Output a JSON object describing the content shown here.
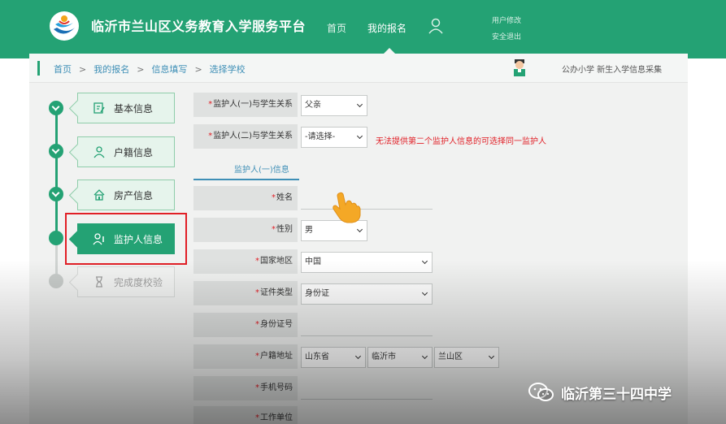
{
  "header": {
    "site_title": "临沂市兰山区义务教育入学服务平台",
    "nav_home": "首页",
    "nav_mine": "我的报名",
    "user_links": [
      "用户修改",
      "安全退出"
    ]
  },
  "breadcrumb": {
    "items": [
      "首页",
      "我的报名",
      "信息填写",
      "选择学校"
    ],
    "separator": ">"
  },
  "page_note": "公办小学 新生入学信息采集",
  "steps": [
    {
      "label": "基本信息",
      "icon": "form-edit-icon",
      "state": "done"
    },
    {
      "label": "户籍信息",
      "icon": "user-icon",
      "state": "done"
    },
    {
      "label": "房产信息",
      "icon": "house-icon",
      "state": "done"
    },
    {
      "label": "监护人信息",
      "icon": "guardian-icon",
      "state": "active"
    },
    {
      "label": "完成度校验",
      "icon": "hourglass-icon",
      "state": "pending"
    }
  ],
  "form": {
    "guardian1_relation": {
      "label": "监护人(一)与学生关系",
      "value": "父亲"
    },
    "guardian2_relation": {
      "label": "监护人(二)与学生关系",
      "value": "-请选择-"
    },
    "warning": "无法提供第二个监护人信息的可选择同一监护人",
    "tab": "监护人(一)信息",
    "name": {
      "label": "姓名",
      "value": ""
    },
    "gender": {
      "label": "性别",
      "value": "男"
    },
    "country": {
      "label": "国家地区",
      "value": "中国"
    },
    "id_type": {
      "label": "证件类型",
      "value": "身份证"
    },
    "id_number": {
      "label": "身份证号",
      "value": ""
    },
    "household": {
      "label": "户籍地址",
      "province": "山东省",
      "city": "临沂市",
      "district": "兰山区"
    },
    "phone": {
      "label": "手机号码",
      "value": ""
    },
    "work": {
      "label": "工作单位"
    }
  },
  "watermark": "临沂第三十四中学",
  "colors": {
    "brand": "#24a274",
    "link": "#3e8fb6",
    "warning": "#e11f26"
  }
}
